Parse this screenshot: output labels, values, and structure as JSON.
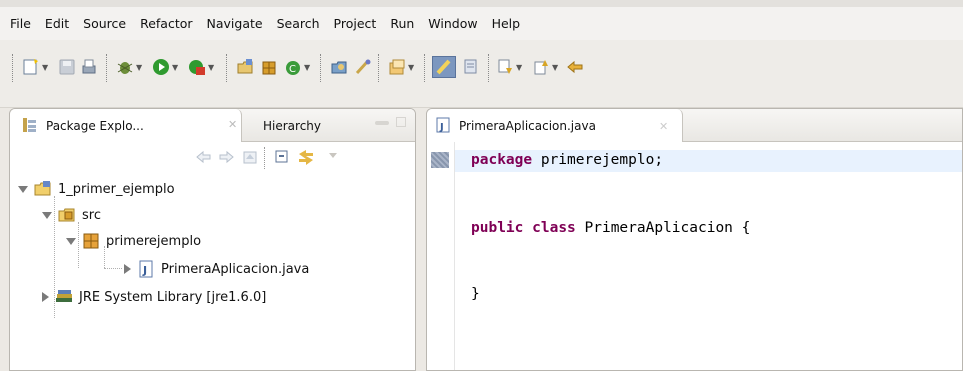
{
  "menubar": {
    "items": [
      "File",
      "Edit",
      "Source",
      "Refactor",
      "Navigate",
      "Search",
      "Project",
      "Run",
      "Window",
      "Help"
    ]
  },
  "toolbar": {
    "icons": [
      "new-wizard-icon",
      "save-icon",
      "print-icon",
      "debug-icon",
      "run-icon",
      "external-tools-icon",
      "new-java-project-icon",
      "new-package-icon",
      "new-class-icon",
      "open-type-icon",
      "search-icon",
      "open-perspective-icon",
      "mark-occurrences-icon",
      "show-whitespace-icon",
      "next-annotation-icon",
      "previous-annotation-icon",
      "back-icon"
    ]
  },
  "left_panel": {
    "tabs": [
      {
        "label": "Package Explo...",
        "active": true
      },
      {
        "label": "Hierarchy",
        "active": false
      }
    ],
    "tree": [
      {
        "label": "1_primer_ejemplo",
        "icon": "java-project-icon",
        "expanded": true
      },
      {
        "label": "src",
        "icon": "source-folder-icon",
        "expanded": true
      },
      {
        "label": "primerejemplo",
        "icon": "package-icon",
        "expanded": true
      },
      {
        "label": "PrimeraAplicacion.java",
        "icon": "java-file-icon",
        "expanded": false
      },
      {
        "label": "JRE System Library [jre1.6.0]",
        "icon": "library-icon",
        "expanded": false
      }
    ]
  },
  "editor": {
    "tab": {
      "label": "PrimeraAplicacion.java"
    },
    "code": {
      "line1": {
        "kw": "package",
        "rest": " primerejemplo;"
      },
      "line2": {
        "kw1": "public",
        "kw2": "class",
        "rest": " PrimeraAplicacion {"
      },
      "line3": {
        "text": "}"
      }
    }
  },
  "colors": {
    "keyword": "#7f0055",
    "current_line": "#e8f2fe",
    "chrome": "#eeece8"
  }
}
